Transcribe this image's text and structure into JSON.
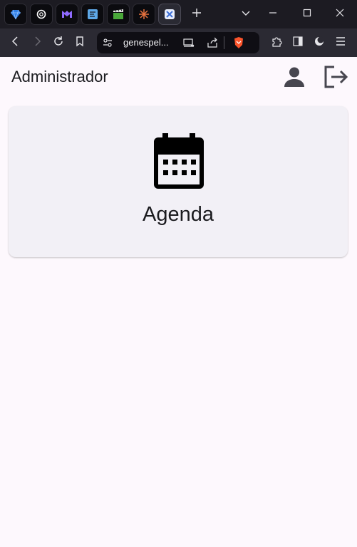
{
  "browser": {
    "tabs": [
      {
        "icon": "gem-icon"
      },
      {
        "icon": "openai-icon"
      },
      {
        "icon": "m-logo-icon"
      },
      {
        "icon": "document-app-icon"
      },
      {
        "icon": "clapperboard-icon"
      },
      {
        "icon": "starburst-icon"
      },
      {
        "icon": "tools-icon"
      }
    ],
    "address_bar": {
      "url": "genespel..."
    }
  },
  "app": {
    "title": "Administrador",
    "card": {
      "label": "Agenda",
      "icon": "calendar-icon"
    }
  },
  "colors": {
    "page_background": "#fdf8fd",
    "card_background": "#f2f0f6",
    "text": "#1b1b1f",
    "icon_gray": "#47464f",
    "chrome_dark": "#1c1b22",
    "brave_orange": "#fb542b"
  }
}
